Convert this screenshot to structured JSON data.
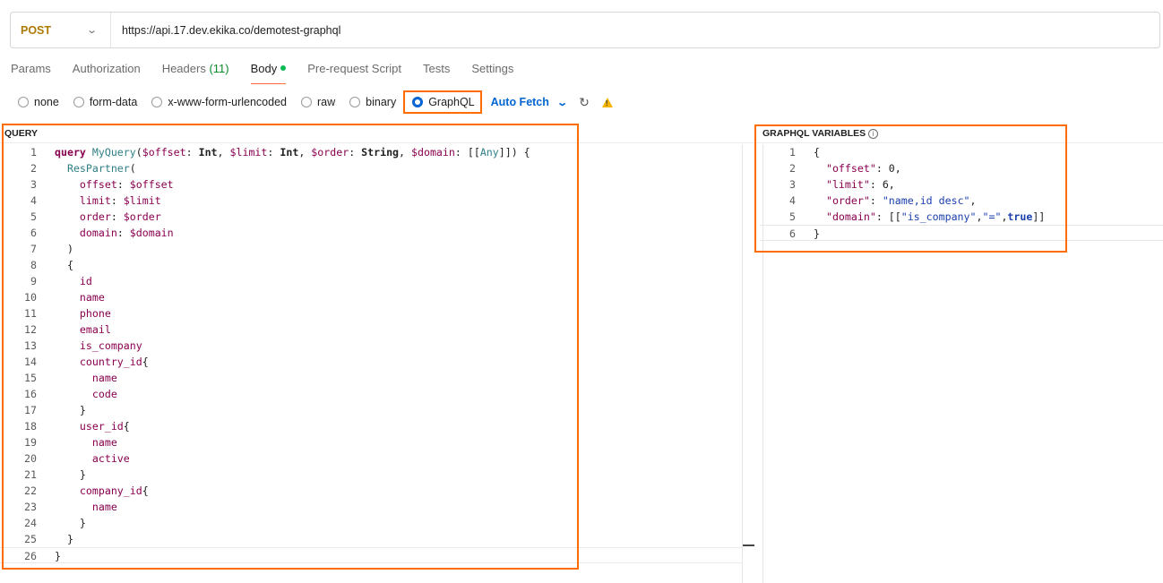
{
  "request": {
    "method": "POST",
    "url": "https://api.17.dev.ekika.co/demotest-graphql"
  },
  "tabs": [
    {
      "label": "Params"
    },
    {
      "label": "Authorization"
    },
    {
      "label": "Headers",
      "count": "(11)"
    },
    {
      "label": "Body"
    },
    {
      "label": "Pre-request Script"
    },
    {
      "label": "Tests"
    },
    {
      "label": "Settings"
    }
  ],
  "body_types": {
    "none": "none",
    "form_data": "form-data",
    "urlencoded": "x-www-form-urlencoded",
    "raw": "raw",
    "binary": "binary",
    "graphql": "GraphQL",
    "selected": "GraphQL"
  },
  "auto_fetch": "Auto Fetch",
  "icons": {
    "refresh": "refresh-icon",
    "warning": "warning-icon",
    "info": "info-icon",
    "chevron": "chevron-down-icon"
  },
  "colors": {
    "accent_orange": "#ff6c00",
    "method_post": "#ad7a03",
    "link_blue": "#0265d2",
    "status_green": "#0cbb52"
  },
  "query_panel": {
    "label": "QUERY",
    "lines": [
      "1",
      "2",
      "3",
      "4",
      "5",
      "6",
      "7",
      "8",
      "9",
      "10",
      "11",
      "12",
      "13",
      "14",
      "15",
      "16",
      "17",
      "18",
      "19",
      "20",
      "21",
      "22",
      "23",
      "24",
      "25",
      "26"
    ]
  },
  "variables_panel": {
    "label": "GRAPHQL VARIABLES",
    "lines": [
      "1",
      "2",
      "3",
      "4",
      "5",
      "6"
    ]
  }
}
